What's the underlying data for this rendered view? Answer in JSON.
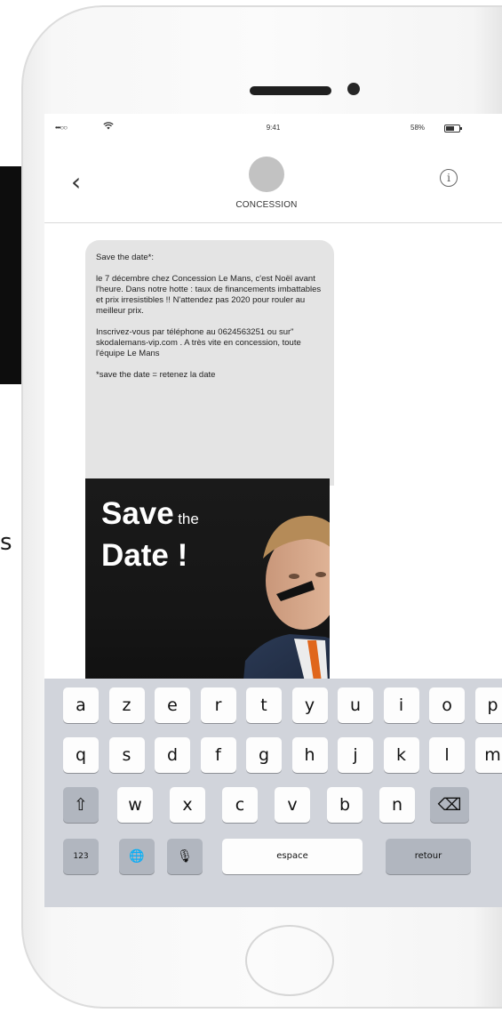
{
  "status_bar": {
    "signal": "•••○○",
    "time": "9:41",
    "battery": "58%"
  },
  "header": {
    "back_icon": "‹",
    "contact_name": "CONCESSION",
    "info_icon": "i"
  },
  "message": {
    "title": "Save the date*:",
    "body": "le 7 décembre chez Concession Le Mans, c'est Noël avant l'heure. Dans notre hotte : taux de financements imbattables et prix irresistibles !! N'attendez pas 2020 pour rouler au meilleur prix.",
    "contact": "Inscrivez-vous par téléphone au 0624563251 ou sur\" skodalemans-vip.com . A très vite en concession, toute l'équipe Le Mans",
    "footnote": "*save the date = retenez la date"
  },
  "mms": {
    "save": "Save",
    "the": "the",
    "date": "Date !"
  },
  "keyboard": {
    "row1": [
      "a",
      "z",
      "e",
      "r",
      "t",
      "y",
      "u",
      "i",
      "o",
      "p"
    ],
    "row2": [
      "q",
      "s",
      "d",
      "f",
      "g",
      "h",
      "j",
      "k",
      "l",
      "m"
    ],
    "row3": [
      "w",
      "x",
      "c",
      "v",
      "b",
      "n"
    ],
    "shift_icon": "⇧",
    "delete_icon": "⌫",
    "numbers_label": "123",
    "globe_icon": "🌐",
    "mic_icon": "🎙",
    "space_label": "espace",
    "return_label": "retour"
  },
  "background": {
    "edge_char": "s"
  }
}
